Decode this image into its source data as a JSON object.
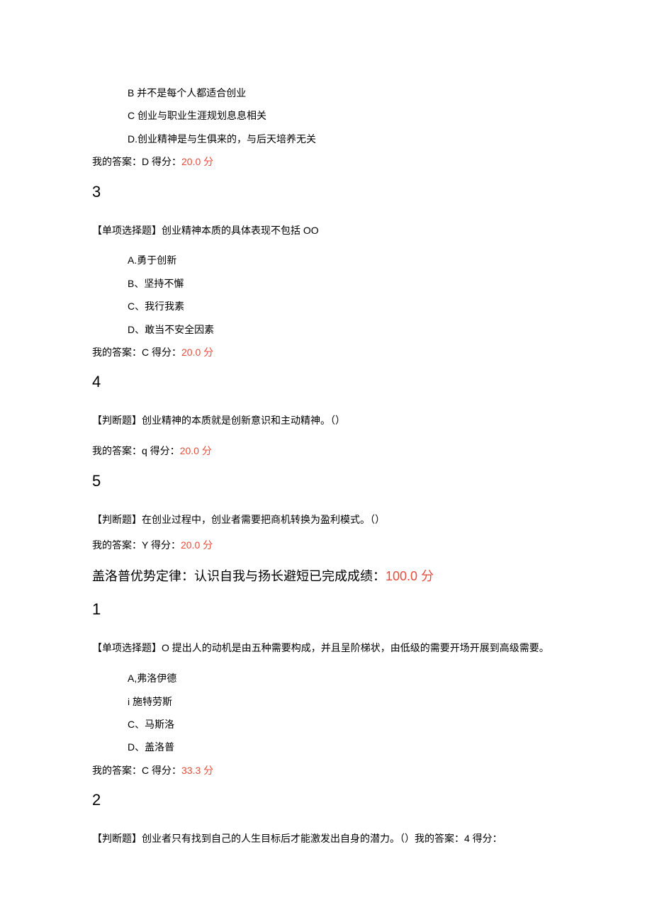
{
  "q2_leading": {
    "optB": "B 并不是每个人都适合创业",
    "optC": "C 创业与职业生涯规划息息相关",
    "optD": "D.创业精神是与生俱来的，与后天培养无关",
    "answerPrefix": "我的答案：D 得分：",
    "score": "20.0 分"
  },
  "q3": {
    "num": "3",
    "stem": "【单项选择题】创业精神本质的具体表现不包括 OO",
    "optA": "A.勇于创新",
    "optB": "B、坚持不懈",
    "optC": "C、我行我素",
    "optD": "D、敢当不安全因素",
    "answerPrefix": "我的答案：C 得分：",
    "score": "20.0 分"
  },
  "q4": {
    "num": "4",
    "stem": "【判断题】创业精神的本质就是创新意识和主动精神。（）",
    "answerPrefix": "我的答案：q 得分：",
    "score": "20.0 分"
  },
  "q5": {
    "num": "5",
    "stem": "【判断题】在创业过程中，创业者需要把商机转换为盈利模式。（）",
    "answerPrefix": "我的答案：Y 得分：",
    "score": "20.0 分"
  },
  "section2": {
    "titlePrefix": "盖洛普优势定律：认识自我与扬长避短已完成成绩：",
    "titleScore": "100.0 分"
  },
  "s2q1": {
    "num": "1",
    "stem": "【单项选择题】O 提出人的动机是由五种需要构成，并且呈阶梯状，由低级的需要开场开展到高级需要。",
    "optA": "A,弗洛伊德",
    "optB": "i 施特劳斯",
    "optC": "C、马斯洛",
    "optD": "D、盖洛普",
    "answerPrefix": "我的答案：C 得分：",
    "score": "33.3 分"
  },
  "s2q2": {
    "num": "2",
    "stem": "【判断题】创业者只有找到自己的人生目标后才能激发出自身的潜力。（）我的答案：4 得分："
  }
}
